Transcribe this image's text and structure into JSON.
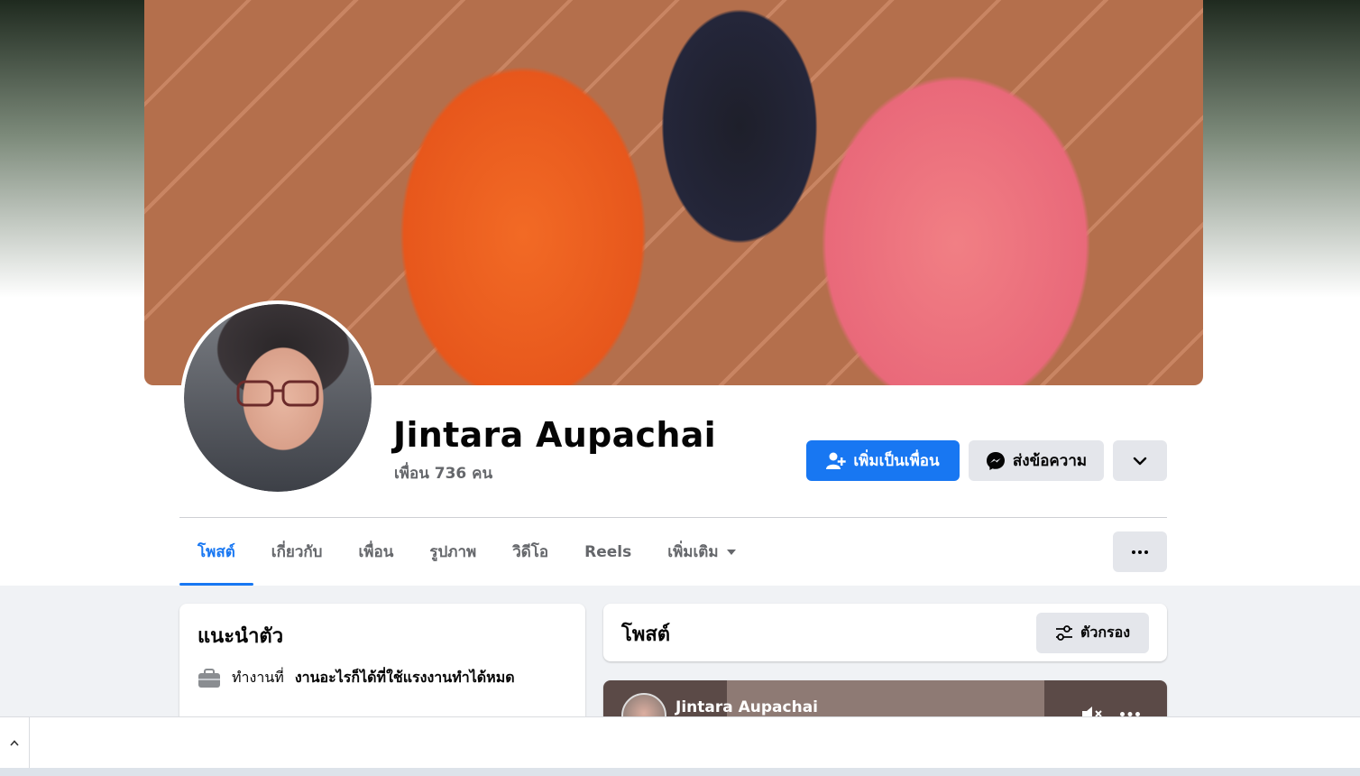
{
  "profile": {
    "name": "Jintara Aupachai",
    "friends_count": "เพื่อน 736 คน"
  },
  "actions": {
    "add_friend": "เพิ่มเป็นเพื่อน",
    "message": "ส่งข้อความ"
  },
  "tabs": [
    {
      "label": "โพสต์",
      "active": true
    },
    {
      "label": "เกี่ยวกับ"
    },
    {
      "label": "เพื่อน"
    },
    {
      "label": "รูปภาพ"
    },
    {
      "label": "วิดีโอ"
    },
    {
      "label": "Reels"
    },
    {
      "label": "เพิ่มเติม"
    }
  ],
  "intro": {
    "title": "แนะนำตัว",
    "work_prefix": "ทำงานที่",
    "workplace": "งานอะไรก็ได้ที่ใช้แรงงานทำได้หมด"
  },
  "posts": {
    "title": "โพสต์",
    "filter_label": "ตัวกรอง",
    "first_post_author": "Jintara Aupachai"
  },
  "colors": {
    "accent": "#1877f2",
    "secondary_button": "#e4e6eb",
    "page_bg": "#f0f2f5"
  }
}
